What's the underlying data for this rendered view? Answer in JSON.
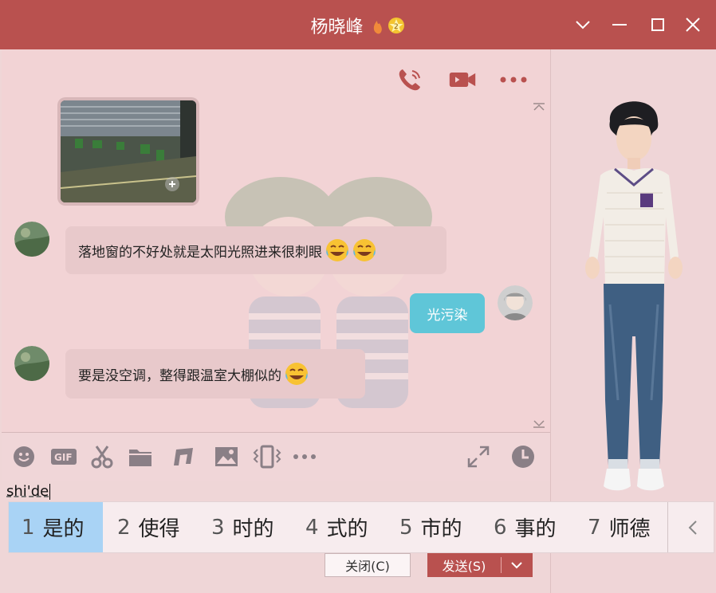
{
  "window": {
    "title": "杨晓峰",
    "accent": "#b9514f"
  },
  "header_actions": [
    {
      "icon": "phone-icon"
    },
    {
      "icon": "video-icon"
    },
    {
      "icon": "more-icon"
    }
  ],
  "messages": [
    {
      "side": "in",
      "text": "落地窗的不好处就是太阳光照进来很刺眼",
      "emoji_count": 2
    },
    {
      "side": "out",
      "text": "光污染",
      "emoji_count": 0
    },
    {
      "side": "in",
      "text": "要是没空调，整得跟温室大棚似的",
      "emoji_count": 1
    }
  ],
  "toolbar": {
    "gif_label": "GIF",
    "icons": [
      "emoji-icon",
      "gif-icon",
      "scissors-icon",
      "folder-icon",
      "music-icon",
      "image-icon",
      "shake-icon",
      "more-icon",
      "expand-icon",
      "history-icon"
    ]
  },
  "input": {
    "value": "shi'de"
  },
  "ime": {
    "candidates": [
      {
        "num": "1",
        "text": "是的"
      },
      {
        "num": "2",
        "text": "使得"
      },
      {
        "num": "3",
        "text": "时的"
      },
      {
        "num": "4",
        "text": "式的"
      },
      {
        "num": "5",
        "text": "市的"
      },
      {
        "num": "6",
        "text": "事的"
      },
      {
        "num": "7",
        "text": "师德"
      }
    ]
  },
  "buttons": {
    "close": "关闭(C)",
    "send": "发送(S)"
  }
}
